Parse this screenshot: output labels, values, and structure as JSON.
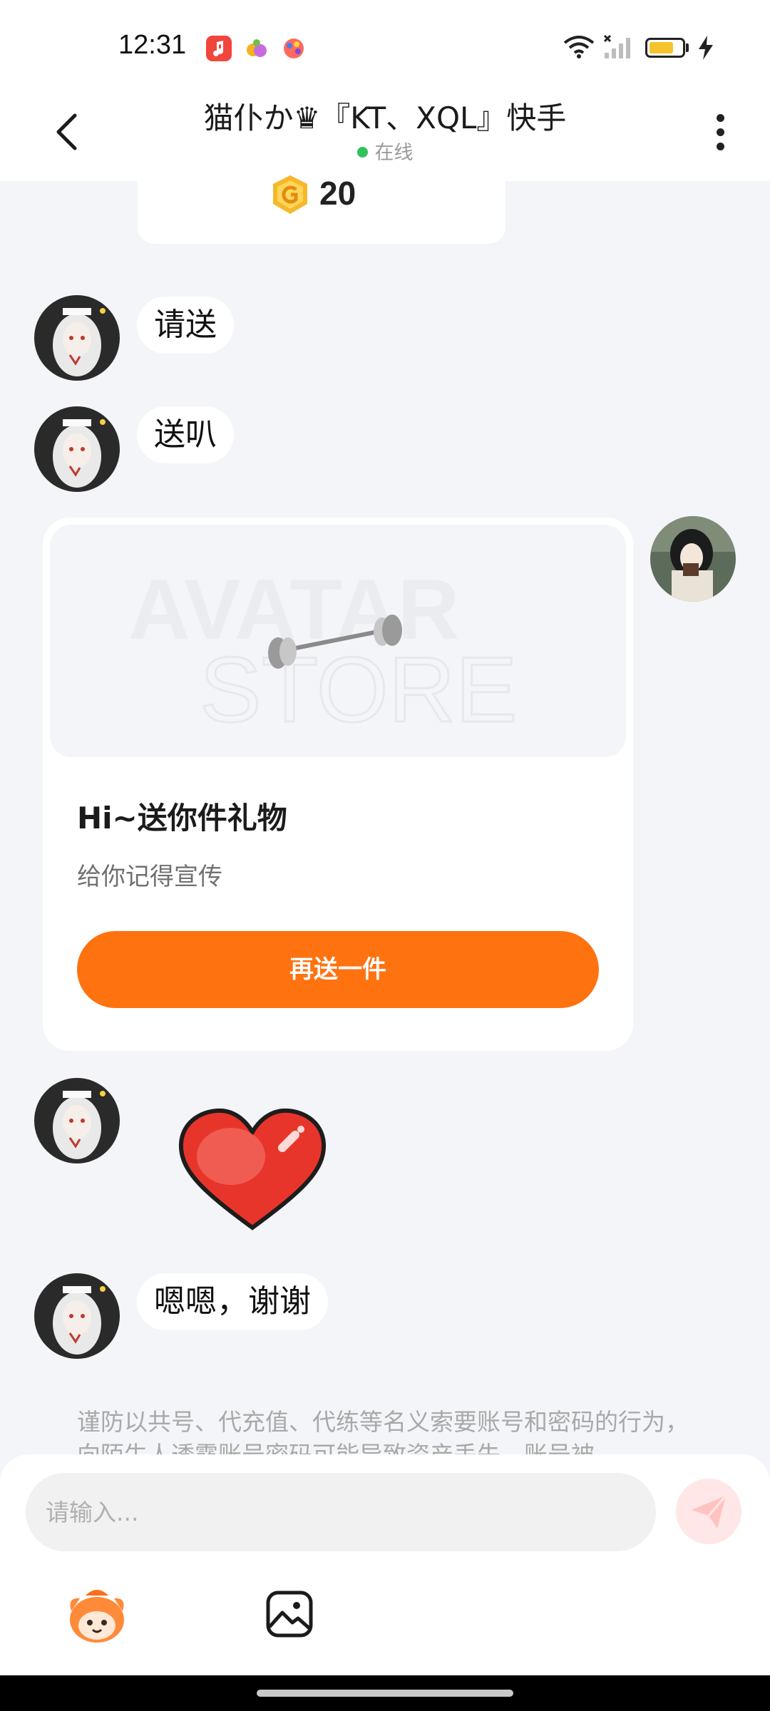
{
  "status_bar": {
    "time": "12:31",
    "battery_level": 0.75,
    "battery_color": "#f5c32c",
    "app_icons": [
      "music-app-icon",
      "fruit-app-icon",
      "paint-app-icon"
    ]
  },
  "header": {
    "title": "猫仆か♛『KT、XQL』快手",
    "online_status": "在线"
  },
  "coin_card": {
    "coin_count": "20"
  },
  "messages": [
    {
      "side": "left",
      "type": "text",
      "text": "请送"
    },
    {
      "side": "left",
      "type": "text",
      "text": "送叭"
    },
    {
      "side": "left",
      "type": "sticker",
      "sticker": "red-heart-sticker"
    },
    {
      "side": "left",
      "type": "text",
      "text": "嗯嗯，谢谢"
    }
  ],
  "gift_card": {
    "watermark_line1": "AVATAR",
    "watermark_line2": "STORE",
    "title": "Hi~送你件礼物",
    "subtitle": "给你记得宣传",
    "button_label": "再送一件"
  },
  "notice": {
    "text": "谨防以共号、代充值、代练等名义索要账号和密码的行为，向陌生人透露账号密码可能导致资产丢失、账号被"
  },
  "input": {
    "placeholder": "请输入..."
  },
  "colors": {
    "accent": "#ff7210",
    "background": "#f3f5f9",
    "online": "#2fc25b"
  }
}
